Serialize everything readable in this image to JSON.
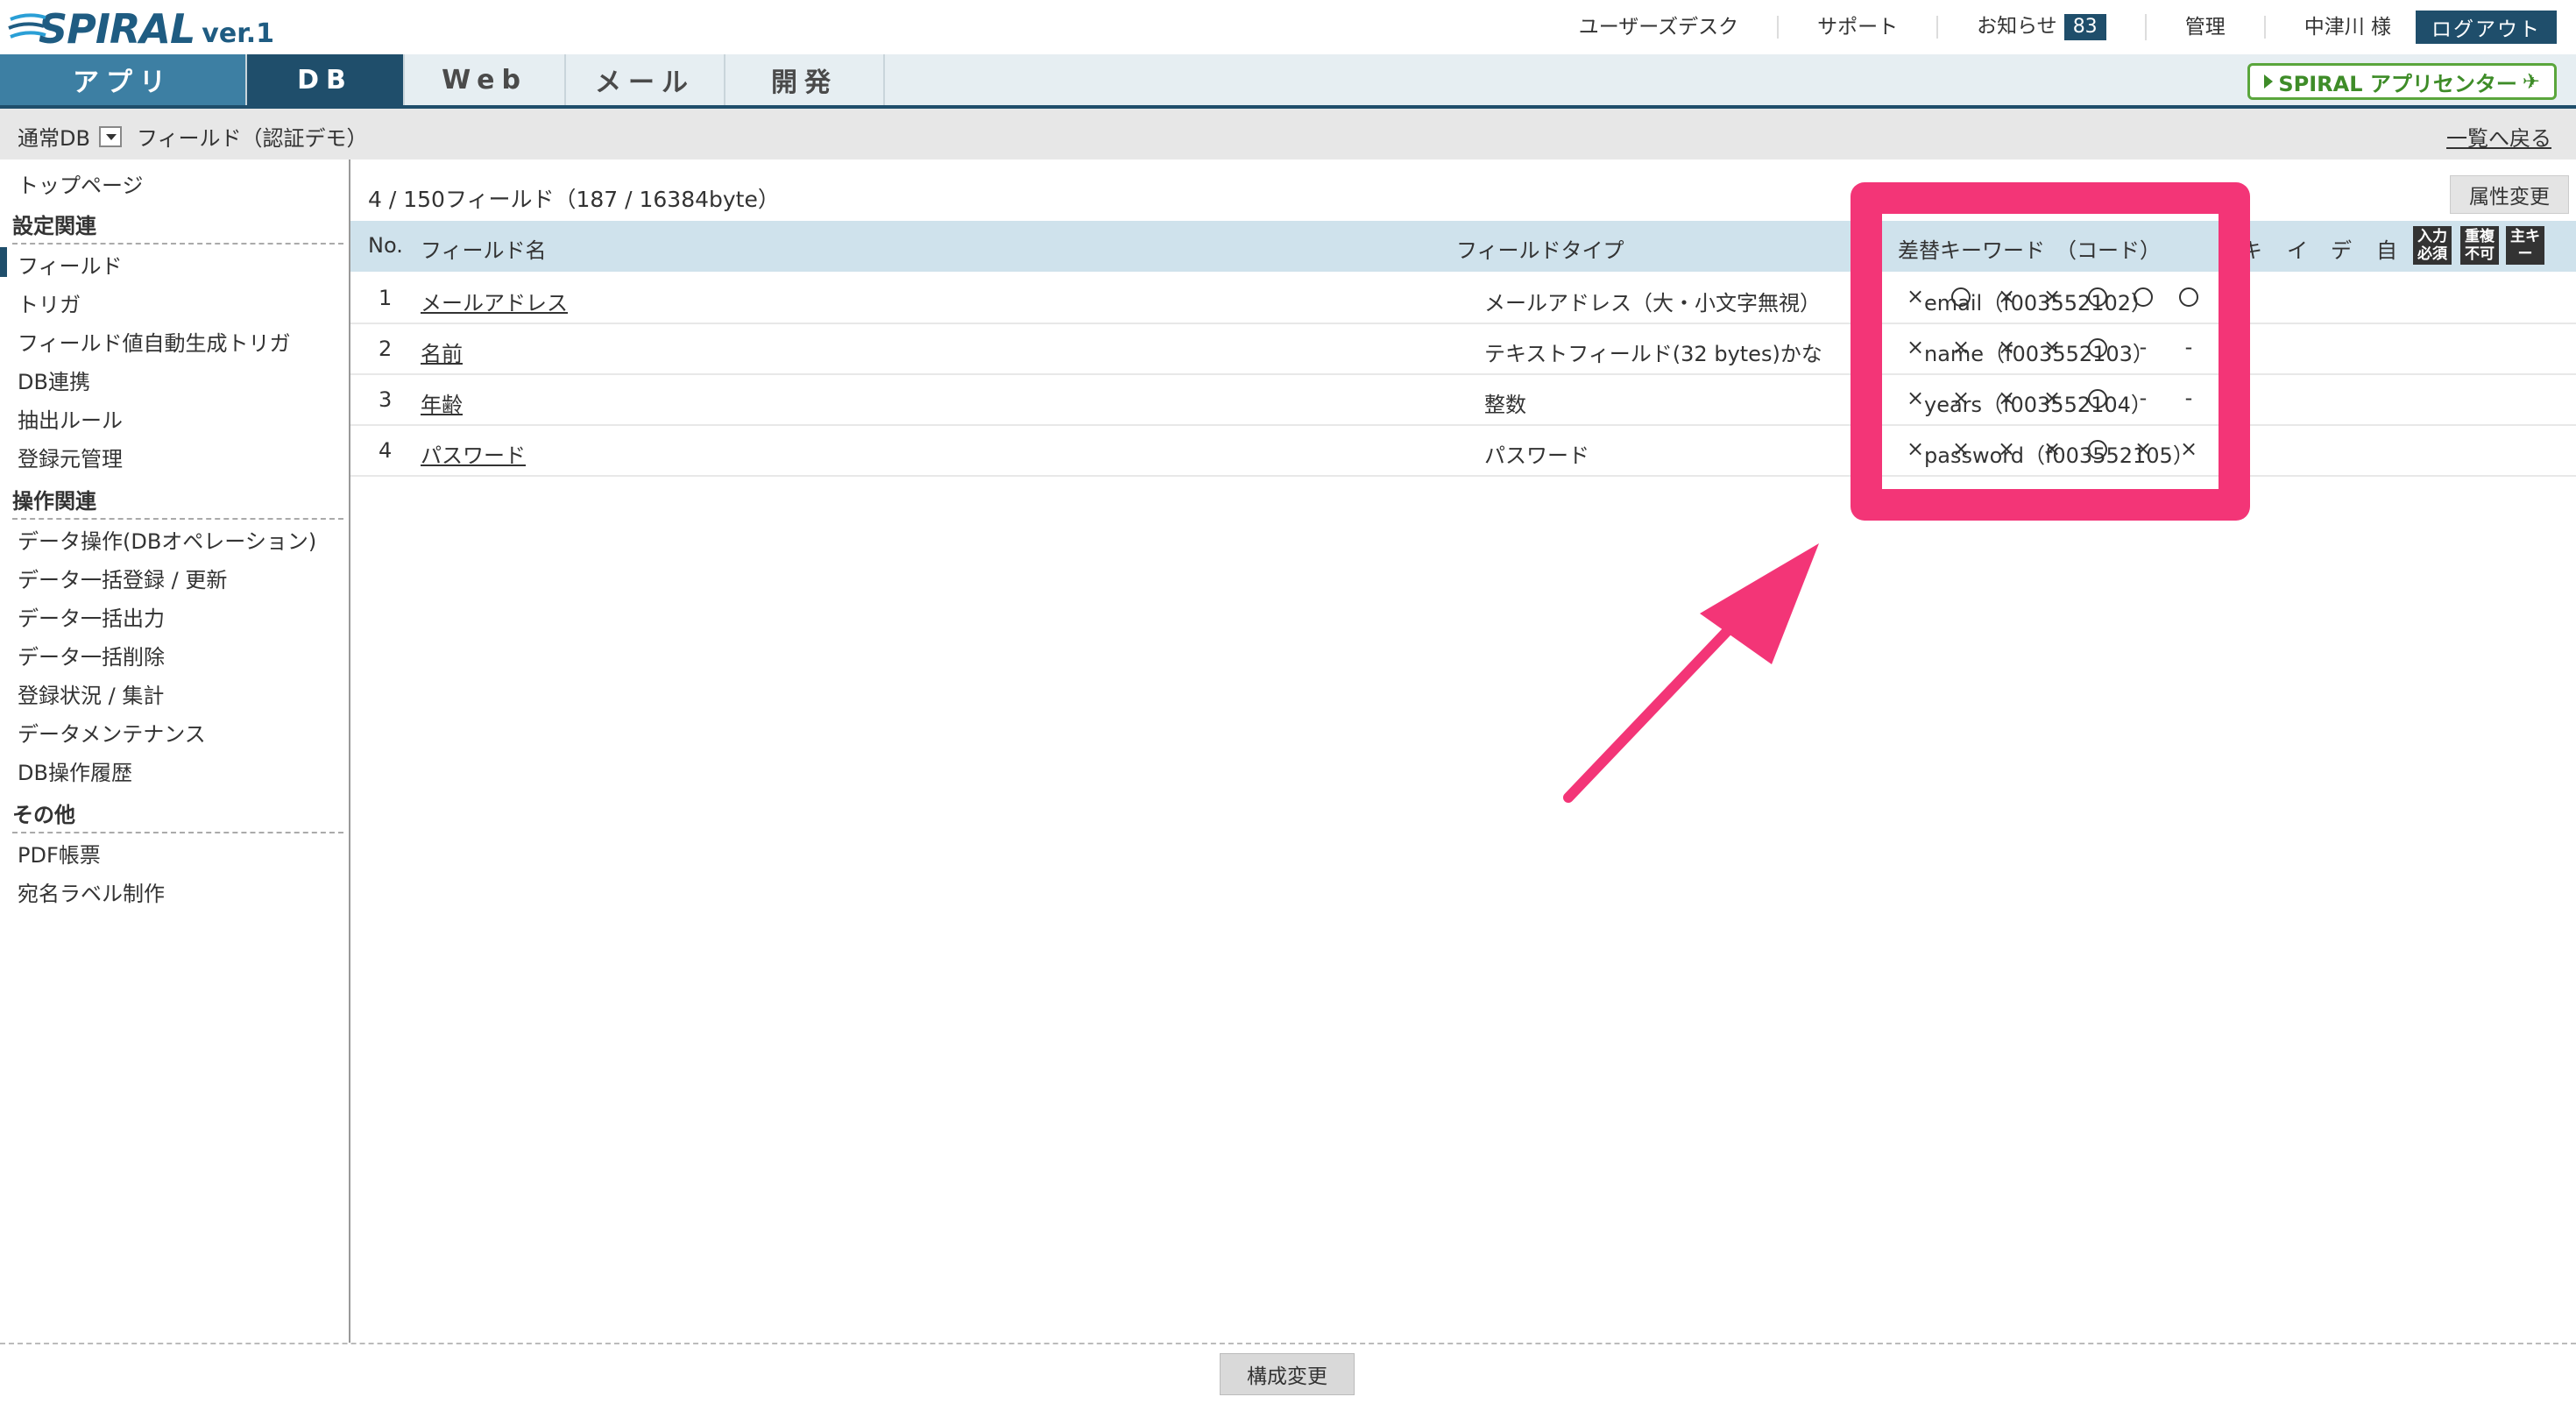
{
  "header": {
    "logo_text": "SPIRAL",
    "logo_version": "ver.1",
    "nav": {
      "users_desk": "ユーザーズデスク",
      "support": "サポート",
      "news": "お知らせ",
      "news_count": "83",
      "admin": "管理",
      "user": "中津川 様",
      "logout": "ログアウト"
    }
  },
  "tabs": {
    "app": "アプリ",
    "db": "DB",
    "web": "Web",
    "mail": "メール",
    "dev": "開発",
    "app_center": "SPIRAL アプリセンター"
  },
  "breadcrumb": {
    "db_type": "通常DB",
    "field": "フィールド（認証デモ）",
    "back": "一覧へ戻る"
  },
  "sidebar": {
    "top": "トップページ",
    "section1": "設定関連",
    "items1": [
      "フィールド",
      "トリガ",
      "フィールド値自動生成トリガ",
      "DB連携",
      "抽出ルール",
      "登録元管理"
    ],
    "section2": "操作関連",
    "items2": [
      "データ操作(DBオペレーション)",
      "データ一括登録 / 更新",
      "データ一括出力",
      "データ一括削除",
      "登録状況 / 集計",
      "データメンテナンス",
      "DB操作履歴"
    ],
    "section3": "その他",
    "items3": [
      "PDF帳票",
      "宛名ラベル制作"
    ]
  },
  "main": {
    "count": "4 / 150フィールド（187 / 16384byte）",
    "attr_button": "属性変更",
    "columns": {
      "no": "No.",
      "name": "フィールド名",
      "type": "フィールドタイプ",
      "keyword": "差替キーワード　（コード）",
      "k": "キ",
      "i": "イ",
      "de": "デ",
      "ji": "自",
      "icon1": "入力必須",
      "icon2": "重複不可",
      "icon3": "主キー"
    },
    "rows": [
      {
        "no": "1",
        "name": "メールアドレス",
        "type": "メールアドレス（大・小文字無視）",
        "keyword": "email（f003552102）",
        "marks": [
          "×",
          "○",
          "×",
          "×",
          "○",
          "○",
          "○"
        ]
      },
      {
        "no": "2",
        "name": "名前",
        "type": "テキストフィールド(32 bytes)かな",
        "keyword": "name（f003552103）",
        "marks": [
          "×",
          "×",
          "×",
          "×",
          "○",
          "-",
          "-"
        ]
      },
      {
        "no": "3",
        "name": "年齢",
        "type": "整数",
        "keyword": "years（f003552104）",
        "marks": [
          "×",
          "×",
          "×",
          "×",
          "○",
          "-",
          "-"
        ]
      },
      {
        "no": "4",
        "name": "パスワード",
        "type": "パスワード",
        "keyword": "password（f003552105）",
        "marks": [
          "×",
          "×",
          "×",
          "×",
          "○",
          "×",
          "×"
        ]
      }
    ]
  },
  "footer": {
    "config_button": "構成変更"
  },
  "colors": {
    "primary": "#1f4e6b",
    "highlight": "#f33577",
    "table_header": "#cfe2ec",
    "app_center": "#5aa63c"
  }
}
